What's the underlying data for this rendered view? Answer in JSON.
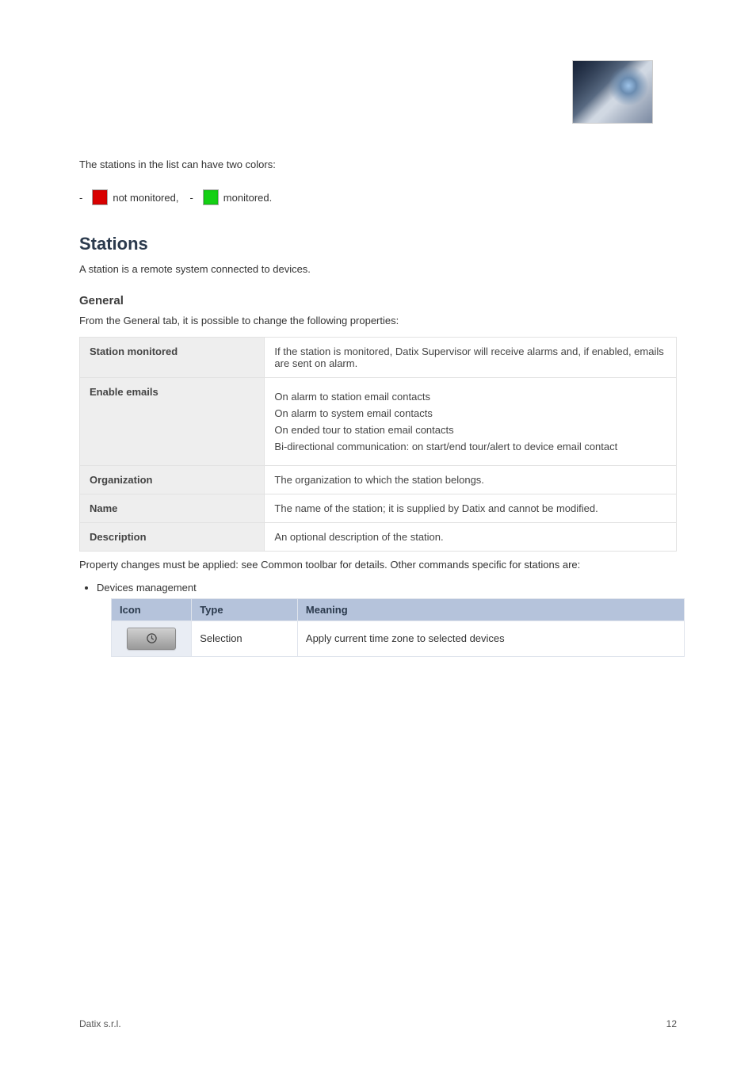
{
  "header": {
    "intro_line": "The stations in the list can have two colors:",
    "swatch_red_label_prefix": "-",
    "swatch_red_label": "not monitored,",
    "swatch_green_label": "monitored."
  },
  "section": {
    "title": "Stations",
    "opening": "A station is a remote system connected to devices."
  },
  "general": {
    "heading": "General",
    "para": "From the General tab, it is possible to change the following properties:",
    "rows": [
      {
        "key": "Station monitored",
        "val": "If the station is monitored, Datix Supervisor will receive alarms and, if enabled, emails are sent on alarm."
      },
      {
        "key": "Enable emails",
        "val_items": [
          "On alarm to station email contacts",
          "On alarm to system email contacts",
          "On ended tour to station email contacts",
          "Bi-directional communication: on start/end tour/alert to device email contact"
        ]
      },
      {
        "key": "Organization",
        "val": "The organization to which the station belongs."
      },
      {
        "key": "Name",
        "val": "The name of the station; it is supplied by Datix and cannot be modified."
      },
      {
        "key": "Description",
        "val": "An optional description of the station."
      }
    ]
  },
  "methods": {
    "intro": "Property changes must be applied: see Common toolbar for details. Other commands specific for stations are:",
    "bullet": "Devices management",
    "table": {
      "headers": [
        "Icon",
        "Type",
        "Meaning"
      ],
      "rows": [
        {
          "icon_name": "clock-icon",
          "type": "Selection",
          "meaning": "Apply current time zone to selected devices"
        }
      ]
    }
  },
  "footer": {
    "company": "Datix s.r.l.",
    "page": "12"
  }
}
